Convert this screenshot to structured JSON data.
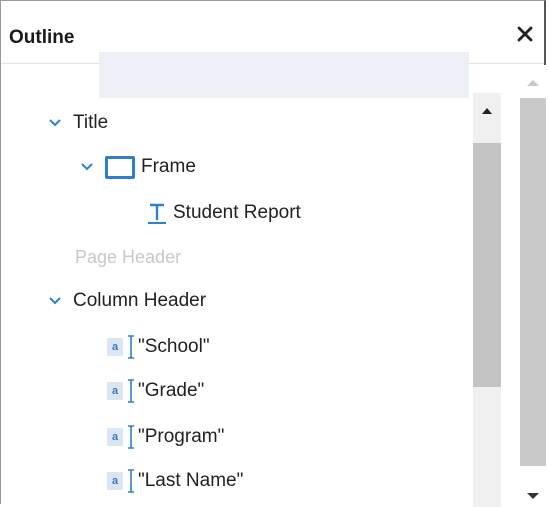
{
  "panel": {
    "title": "Outline",
    "close_icon": "close-icon"
  },
  "tree": {
    "title_band": {
      "label": "Title",
      "expanded": true
    },
    "frame": {
      "label": "Frame",
      "expanded": true,
      "selected": true,
      "icon": "frame-icon"
    },
    "student_report": {
      "label": "Student Report",
      "icon": "text-element-icon"
    },
    "page_header": {
      "label": "Page Header",
      "disabled": true
    },
    "column_header": {
      "label": "Column Header",
      "expanded": true
    },
    "fields": [
      {
        "label": "\"School\"",
        "icon": "text-field-icon",
        "glyph": "a"
      },
      {
        "label": "\"Grade\"",
        "icon": "text-field-icon",
        "glyph": "a"
      },
      {
        "label": "\"Program\"",
        "icon": "text-field-icon",
        "glyph": "a"
      },
      {
        "label": "\"Last Name\"",
        "icon": "text-field-icon",
        "glyph": "a"
      }
    ]
  },
  "colors": {
    "accent": "#2e7fcf",
    "selection": "#edf0f7",
    "disabled_text": "#c8c8c8"
  }
}
